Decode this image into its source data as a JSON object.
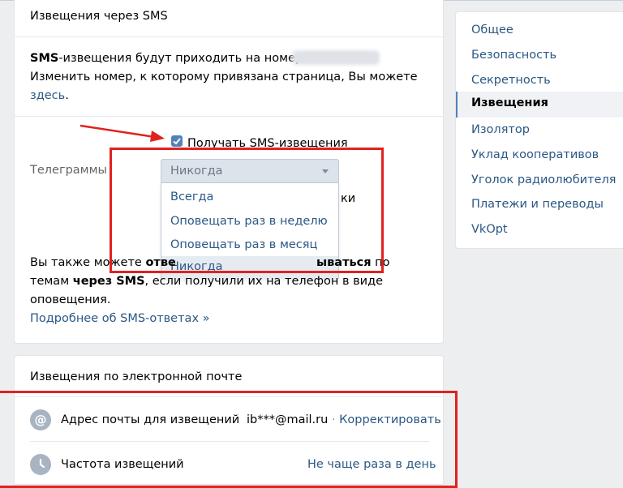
{
  "sms": {
    "title": "Извещения через SMS",
    "number_bold": "SMS",
    "number_text": "-извещения будут приходить на номер +",
    "change_text": "Изменить номер, к которому привязана страница, Вы можете",
    "change_link": "здесь",
    "change_end": ".",
    "checkbox_label": "Получать SMS-извещения",
    "telegram_label": "Телеграммы",
    "select_value": "Никогда",
    "options": [
      "Всегда",
      "Оповещать раз в неделю",
      "Оповещать раз в месяц",
      "Никогда"
    ],
    "hidden_tail": "ки",
    "info_1": "Вы также можете ",
    "info_bold_1": "отве",
    "info_bold_2": "ываться",
    "info_2": " по",
    "info_3": "темам ",
    "info_bold_3": "через SMS",
    "info_4": ", если получили их на телефон в виде",
    "info_5": "оповещения.",
    "more_link": "Подробнее об SMS-ответах »"
  },
  "email": {
    "title": "Извещения по электронной почте",
    "address_label": "Адрес почты для извещений",
    "address_value": "ib***@mail.ru",
    "separator": " · ",
    "edit_link": "Корректировать",
    "frequency_label": "Частота извещений",
    "frequency_value": "Не чаще раза в день",
    "at_glyph": "@"
  },
  "menu": {
    "items": [
      "Общее",
      "Безопасность",
      "Секретность",
      "Извещения",
      "Изолятор",
      "Уклад кооперативов",
      "Уголок радиолюбителя",
      "Платежи и переводы",
      "VkOpt"
    ],
    "active_index": 3
  },
  "colors": {
    "link": "#2a5885",
    "accent": "#5181b8",
    "annotation": "#e0221f"
  }
}
